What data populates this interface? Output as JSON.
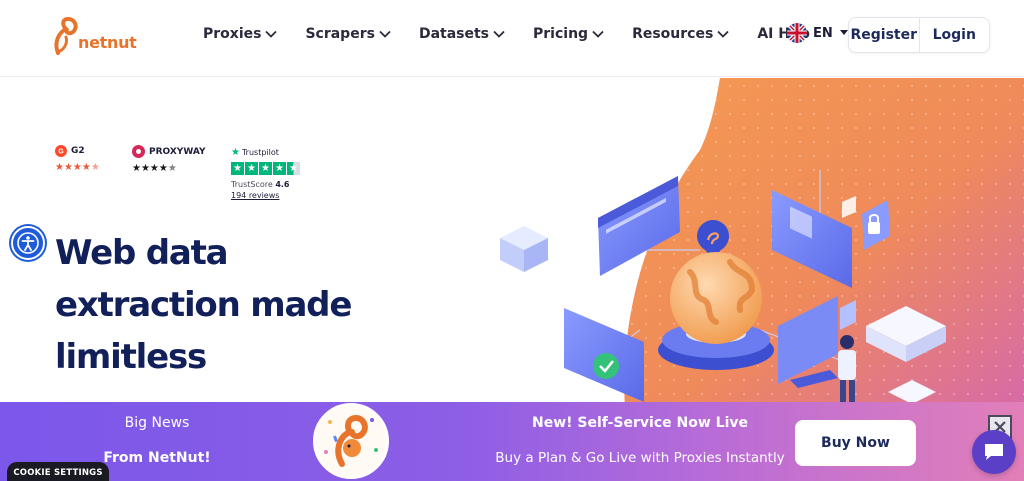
{
  "header": {
    "logo_text": "netnut",
    "nav": [
      {
        "label": "Proxies",
        "has_dropdown": true
      },
      {
        "label": "Scrapers",
        "has_dropdown": true
      },
      {
        "label": "Datasets",
        "has_dropdown": true
      },
      {
        "label": "Pricing",
        "has_dropdown": true
      },
      {
        "label": "Resources",
        "has_dropdown": true
      },
      {
        "label": "AI Hub",
        "has_dropdown": false
      }
    ],
    "language": "EN",
    "register_label": "Register",
    "login_label": "Login"
  },
  "ratings": {
    "g2": {
      "name": "G2",
      "stars": 4.5
    },
    "proxyway": {
      "name": "PROXYWAY",
      "stars": 4.5
    },
    "trustpilot": {
      "name": "Trustpilot",
      "trustscore_label": "TrustScore",
      "trustscore_value": "4.6",
      "reviews": "194 reviews",
      "stars": 4.5
    }
  },
  "hero": {
    "headline_line1": "Web data",
    "headline_line2": "extraction made",
    "headline_line3": "limitless"
  },
  "banner": {
    "big_news": "Big News",
    "from": "From NetNut!",
    "new_service": "New! Self-Service Now Live",
    "subtitle": "Buy a Plan & Go Live with Proxies Instantly",
    "buy_now_label": "Buy Now"
  },
  "cookie_label": "COOKIE SETTINGS",
  "colors": {
    "brand_orange": "#e8742c",
    "navy": "#12205a",
    "banner_purple": "#7b57ea",
    "banner_pink": "#e27fb9",
    "trustpilot_green": "#00b67a"
  }
}
